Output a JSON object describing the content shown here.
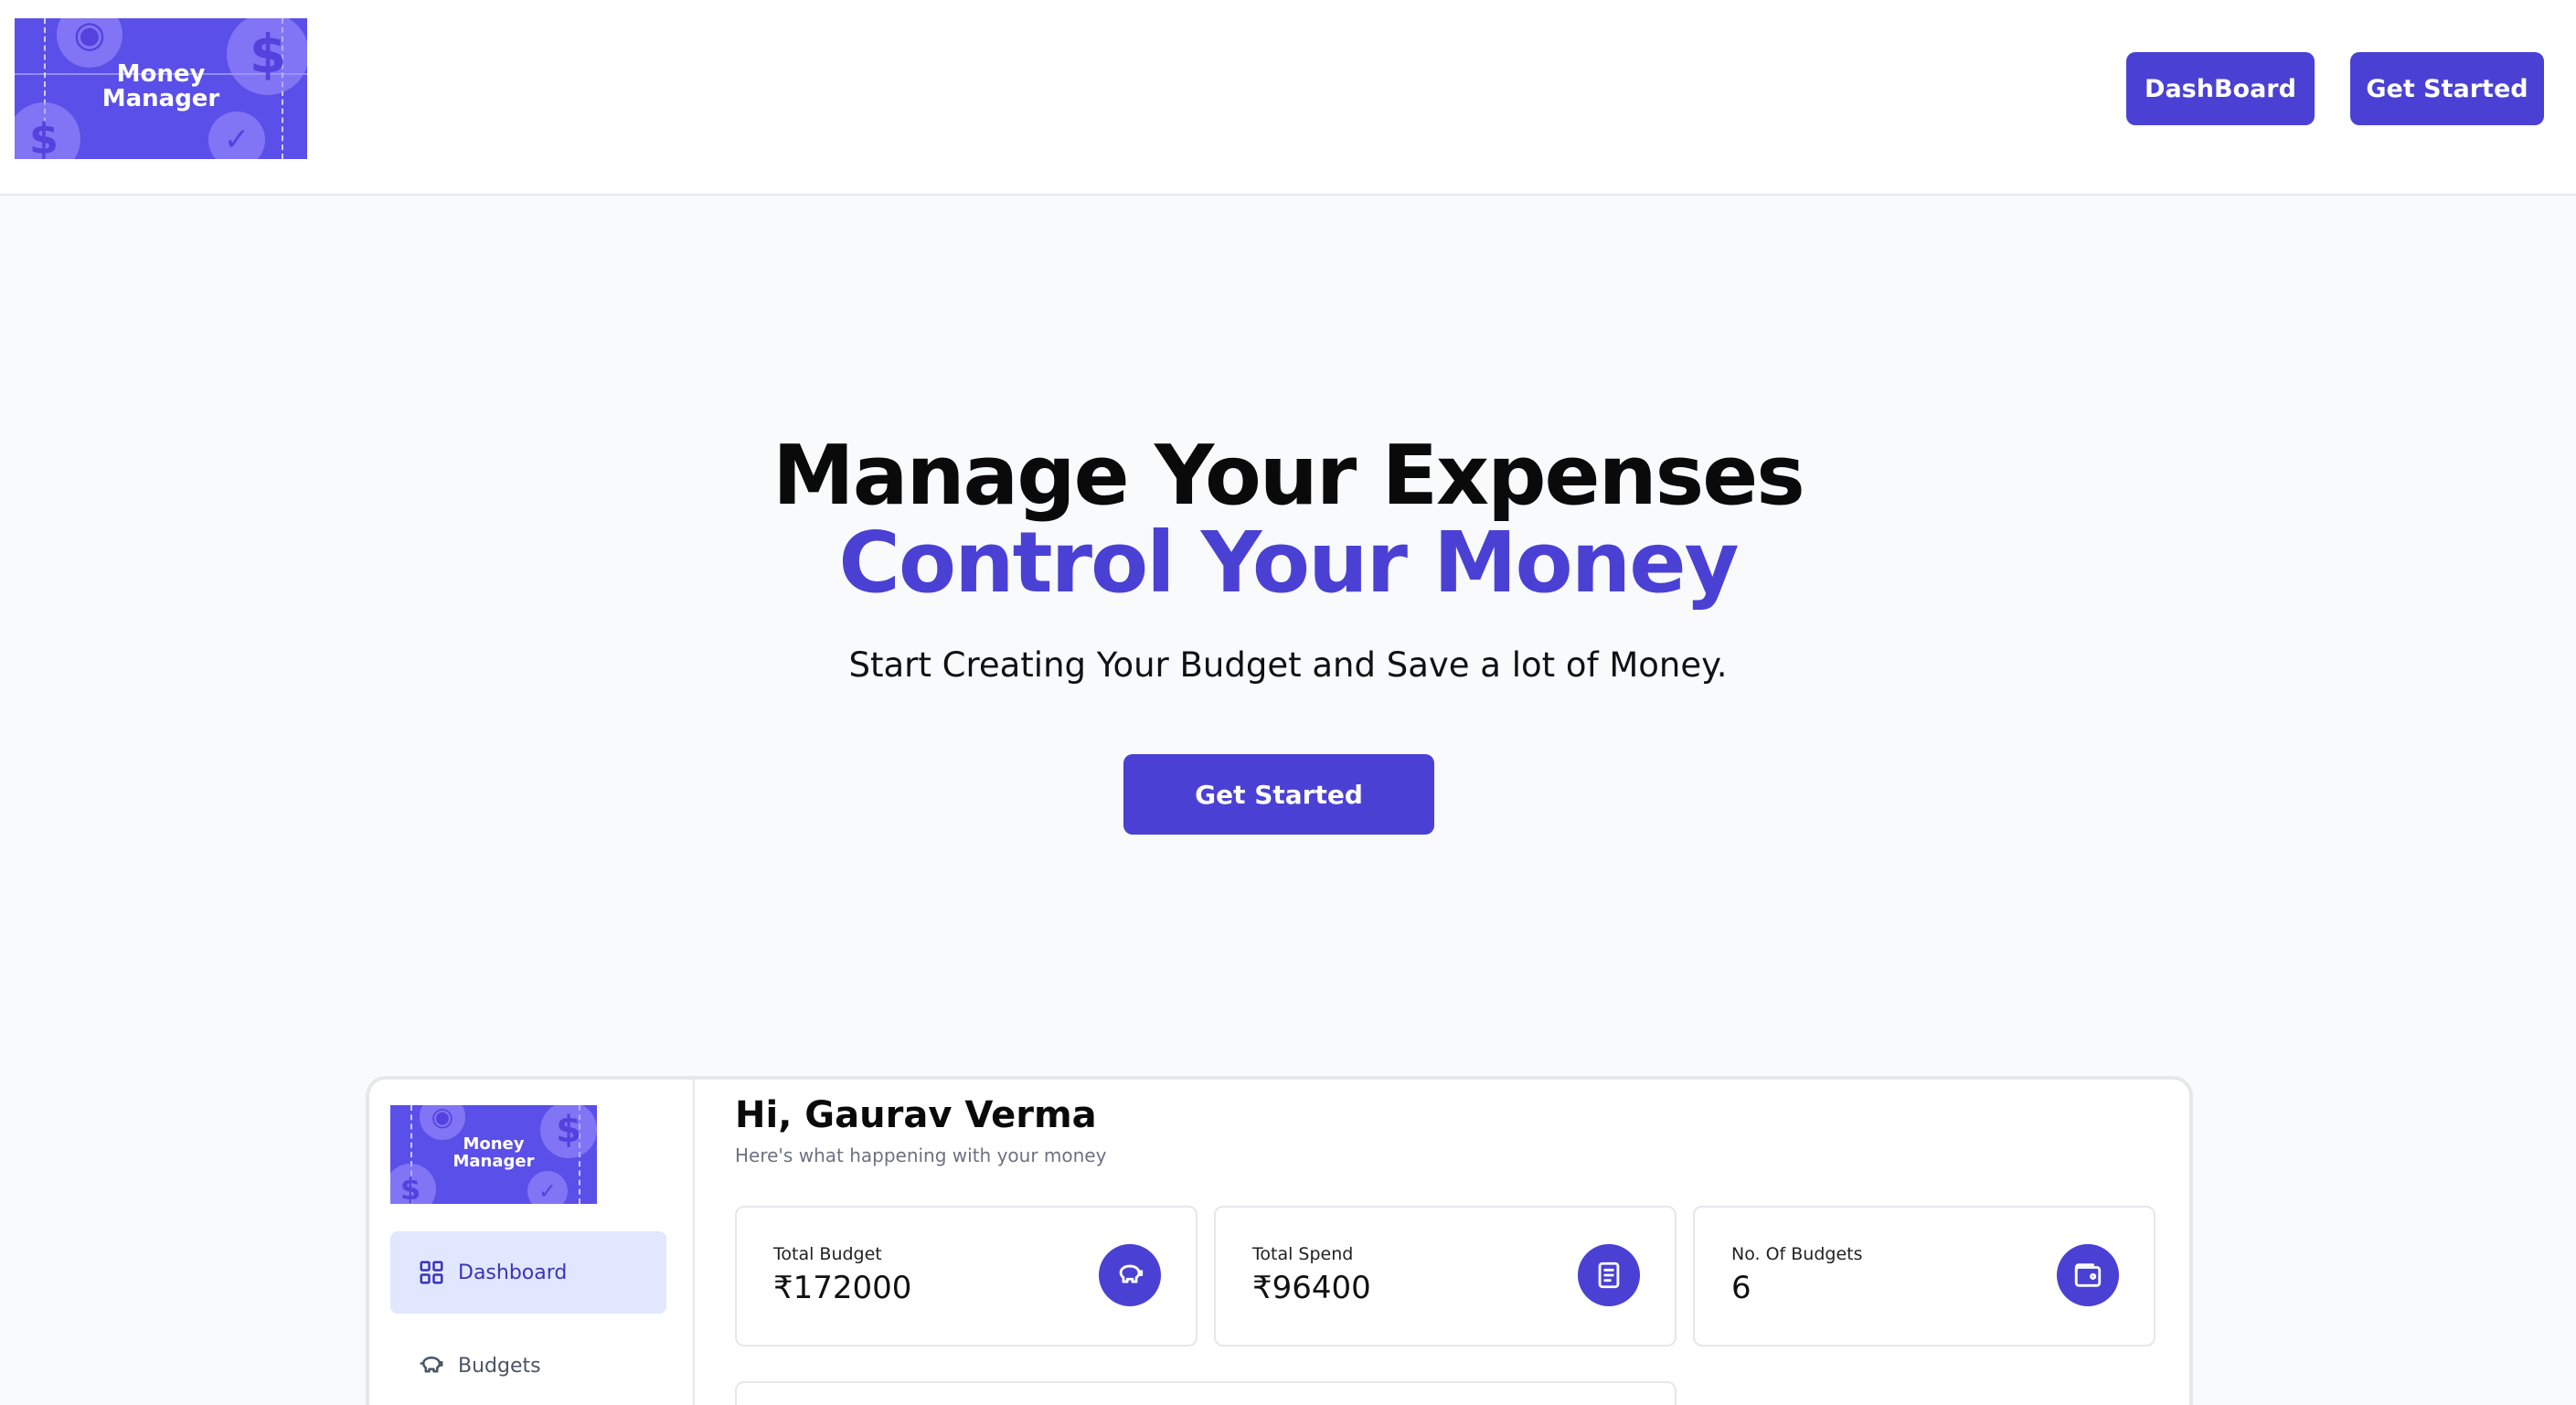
{
  "header": {
    "logo_line1": "Money",
    "logo_line2": "Manager",
    "dashboard_label": "DashBoard",
    "get_started_label": "Get Started"
  },
  "hero": {
    "title_line1": "Manage Your Expenses",
    "title_line2": "Control Your Money",
    "subtitle": "Start Creating Your Budget and Save a lot of Money.",
    "cta_label": "Get Started"
  },
  "preview": {
    "logo_line1": "Money",
    "logo_line2": "Manager",
    "sidebar": {
      "items": [
        {
          "label": "Dashboard",
          "icon": "grid-icon",
          "active": true
        },
        {
          "label": "Budgets",
          "icon": "piggy-bank-icon",
          "active": false
        }
      ]
    },
    "greeting": "Hi, Gaurav Verma",
    "greeting_sub": "Here's what happening with your money",
    "cards": [
      {
        "label": "Total Budget",
        "value": "₹172000",
        "icon": "piggy-bank-icon"
      },
      {
        "label": "Total Spend",
        "value": "₹96400",
        "icon": "receipt-icon"
      },
      {
        "label": "No. Of Budgets",
        "value": "6",
        "icon": "wallet-icon"
      }
    ]
  },
  "colors": {
    "accent": "#4a41d4",
    "logo_bg": "#5b4fe9",
    "page_bg": "#f9fafb",
    "active_bg": "#e0e7ff"
  }
}
